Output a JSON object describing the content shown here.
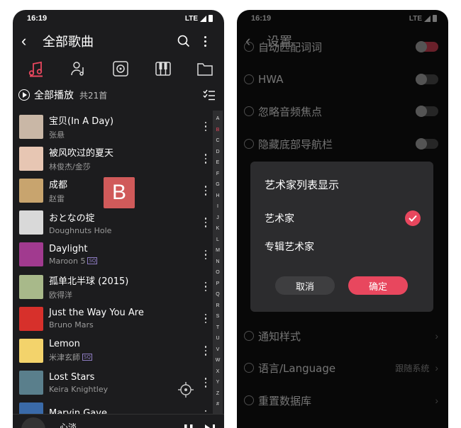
{
  "status": {
    "time": "16:19",
    "network": "LTE"
  },
  "left": {
    "title": "全部歌曲",
    "playall_label": "全部播放",
    "playall_count": "共21首",
    "section_letter": "B",
    "songs": [
      {
        "title": "宝贝(In A Day)",
        "artist": "张悬",
        "sq": "",
        "cover": "#c9b7a6"
      },
      {
        "title": "被风吹过的夏天",
        "artist": "林俊杰/金莎",
        "sq": "",
        "cover": "#e7c6b3"
      },
      {
        "title": "成都",
        "artist": "赵雷",
        "sq": "",
        "cover": "#c8a46e"
      },
      {
        "title": "おとなの掟",
        "artist": "Doughnuts Hole",
        "sq": "",
        "cover": "#d9d9d9"
      },
      {
        "title": "Daylight",
        "artist": "Maroon 5",
        "sq": "SQ",
        "cover": "#a13a8f"
      },
      {
        "title": "孤单北半球 (2015)",
        "artist": "欧得洋",
        "sq": "",
        "cover": "#a8b98a"
      },
      {
        "title": "Just the Way You Are",
        "artist": "Bruno Mars",
        "sq": "",
        "cover": "#d7302b"
      },
      {
        "title": "Lemon",
        "artist": "米津玄師",
        "sq": "SQ",
        "cover": "#f3d36b"
      },
      {
        "title": "Lost Stars",
        "artist": "Keira Knightley",
        "sq": "",
        "cover": "#5a7f8c"
      },
      {
        "title": "Marvin Gaye",
        "artist": "",
        "sq": "",
        "cover": "#3a6aa8"
      }
    ],
    "az_index": [
      "A",
      "B",
      "C",
      "D",
      "E",
      "F",
      "G",
      "H",
      "I",
      "J",
      "K",
      "L",
      "M",
      "N",
      "O",
      "P",
      "Q",
      "R",
      "S",
      "T",
      "U",
      "V",
      "W",
      "X",
      "Y",
      "Z",
      "#"
    ],
    "az_active": "B",
    "mini_player_title": "心淡"
  },
  "right": {
    "title": "设置",
    "rows": [
      {
        "label": "自动匹配词词",
        "value": "",
        "control": "toggle-on"
      },
      {
        "label": "HWA",
        "value": "",
        "control": "toggle"
      },
      {
        "label": "忽略音频焦点",
        "value": "",
        "control": "toggle"
      },
      {
        "label": "隐藏底部导航栏",
        "value": "",
        "control": "toggle"
      },
      {
        "label": "通知样式",
        "value": "",
        "control": "chevron"
      },
      {
        "label": "语言/Language",
        "value": "跟随系统",
        "control": "chevron"
      },
      {
        "label": "重置数据库",
        "value": "",
        "control": "chevron"
      }
    ],
    "dialog": {
      "title": "艺术家列表显示",
      "option1": "艺术家",
      "option2": "专辑艺术家",
      "cancel": "取消",
      "ok": "确定"
    }
  },
  "colors": {
    "accent": "#e8475e",
    "background": "#1c1c1e"
  }
}
